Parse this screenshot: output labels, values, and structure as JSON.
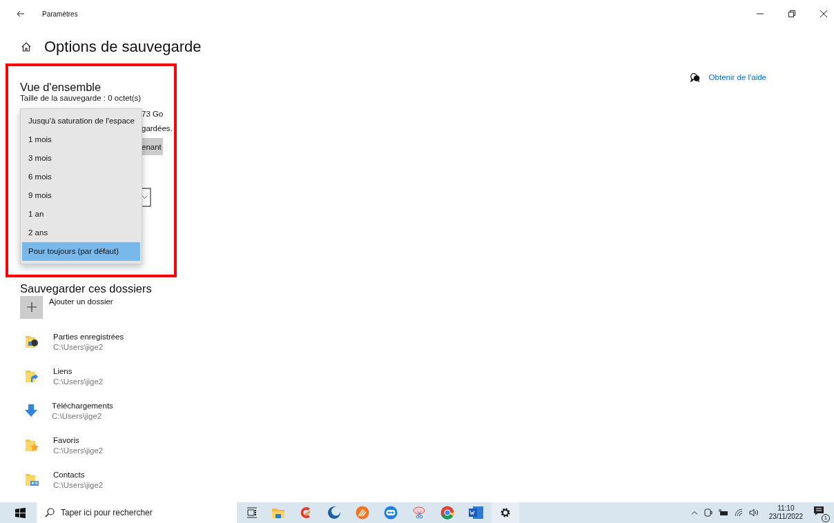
{
  "window": {
    "title": "Paramètres"
  },
  "page": {
    "title": "Options de sauvegarde"
  },
  "help_link": "Obtenir de l'aide",
  "overview": {
    "heading": "Vue d'ensemble",
    "backup_size": "Taille de la sauvegarde : 0 octet(s)",
    "partial_texts": [
      "73 Go",
      "gardées."
    ],
    "button_partial": "enant"
  },
  "dropdown": {
    "options": [
      {
        "label": "Jusqu'à saturation de l'espace",
        "selected": false
      },
      {
        "label": "1 mois",
        "selected": false
      },
      {
        "label": "3 mois",
        "selected": false
      },
      {
        "label": "6 mois",
        "selected": false
      },
      {
        "label": "9 mois",
        "selected": false
      },
      {
        "label": "1 an",
        "selected": false
      },
      {
        "label": "2 ans",
        "selected": false
      },
      {
        "label": "Pour toujours (par défaut)",
        "selected": true
      }
    ]
  },
  "folders_section": {
    "heading": "Sauvegarder ces dossiers",
    "add_label": "Ajouter un dossier",
    "folders": [
      {
        "name": "Parties enregistrées",
        "path": "C:\\Users\\jige2",
        "kind": "games"
      },
      {
        "name": "Liens",
        "path": "C:\\Users\\jige2",
        "kind": "links"
      },
      {
        "name": "Téléchargements",
        "path": "C:\\Users\\jige2",
        "kind": "downloads"
      },
      {
        "name": "Favoris",
        "path": "C:\\Users\\jige2",
        "kind": "favorites"
      },
      {
        "name": "Contacts",
        "path": "C:\\Users\\jige2",
        "kind": "contacts"
      }
    ]
  },
  "taskbar": {
    "search_placeholder": "Taper ici pour rechercher",
    "time": "11:10",
    "date": "23/11/2022",
    "notification_count": "1"
  }
}
